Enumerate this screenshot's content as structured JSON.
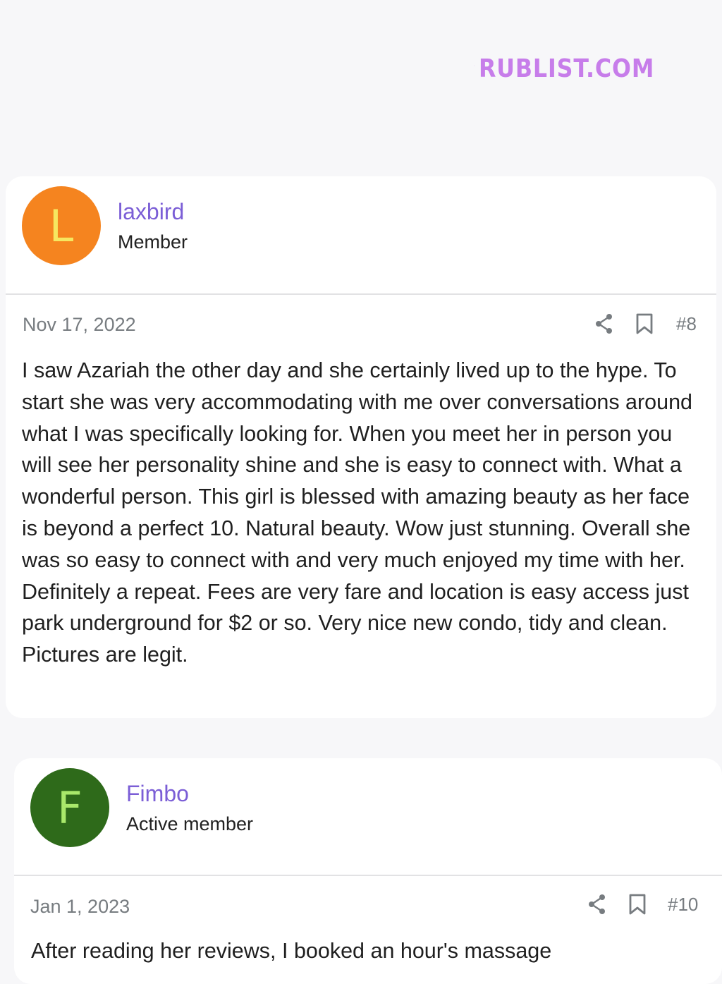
{
  "watermark": {
    "text": "RUBLIST.COM"
  },
  "posts": [
    {
      "avatar_letter": "L",
      "avatar_bg": "#f5841f",
      "avatar_fg": "#f6e760",
      "username": "laxbird",
      "role": "Member",
      "date": "Nov 17, 2022",
      "post_number": "#8",
      "icons": {
        "share": "share-icon",
        "bookmark": "bookmark-icon"
      },
      "body": "I saw Azariah the other day and she certainly lived up to the hype. To start she was very accommodating with me over conversations around what I was specifically looking for. When you meet her in person you will see her personality shine and she is easy to connect with. What a wonderful person. This girl is blessed with amazing beauty as her face is beyond a perfect 10. Natural beauty. Wow just stunning. Overall she was so easy to connect with and very much enjoyed my time with her. Definitely a repeat. Fees are very fare and location is easy access just park underground for $2 or so. Very nice new condo, tidy and clean. Pictures are legit."
    },
    {
      "avatar_letter": "F",
      "avatar_bg": "#2e6a1a",
      "avatar_fg": "#a9e86b",
      "username": "Fimbo",
      "role": "Active member",
      "date": "Jan 1, 2023",
      "post_number": "#10",
      "icons": {
        "share": "share-icon",
        "bookmark": "bookmark-icon"
      },
      "body": "After reading her reviews, I booked an hour's massage"
    }
  ],
  "colors": {
    "username": "#7b5ed6",
    "meta": "#777c80",
    "watermark": "#c77dea"
  }
}
